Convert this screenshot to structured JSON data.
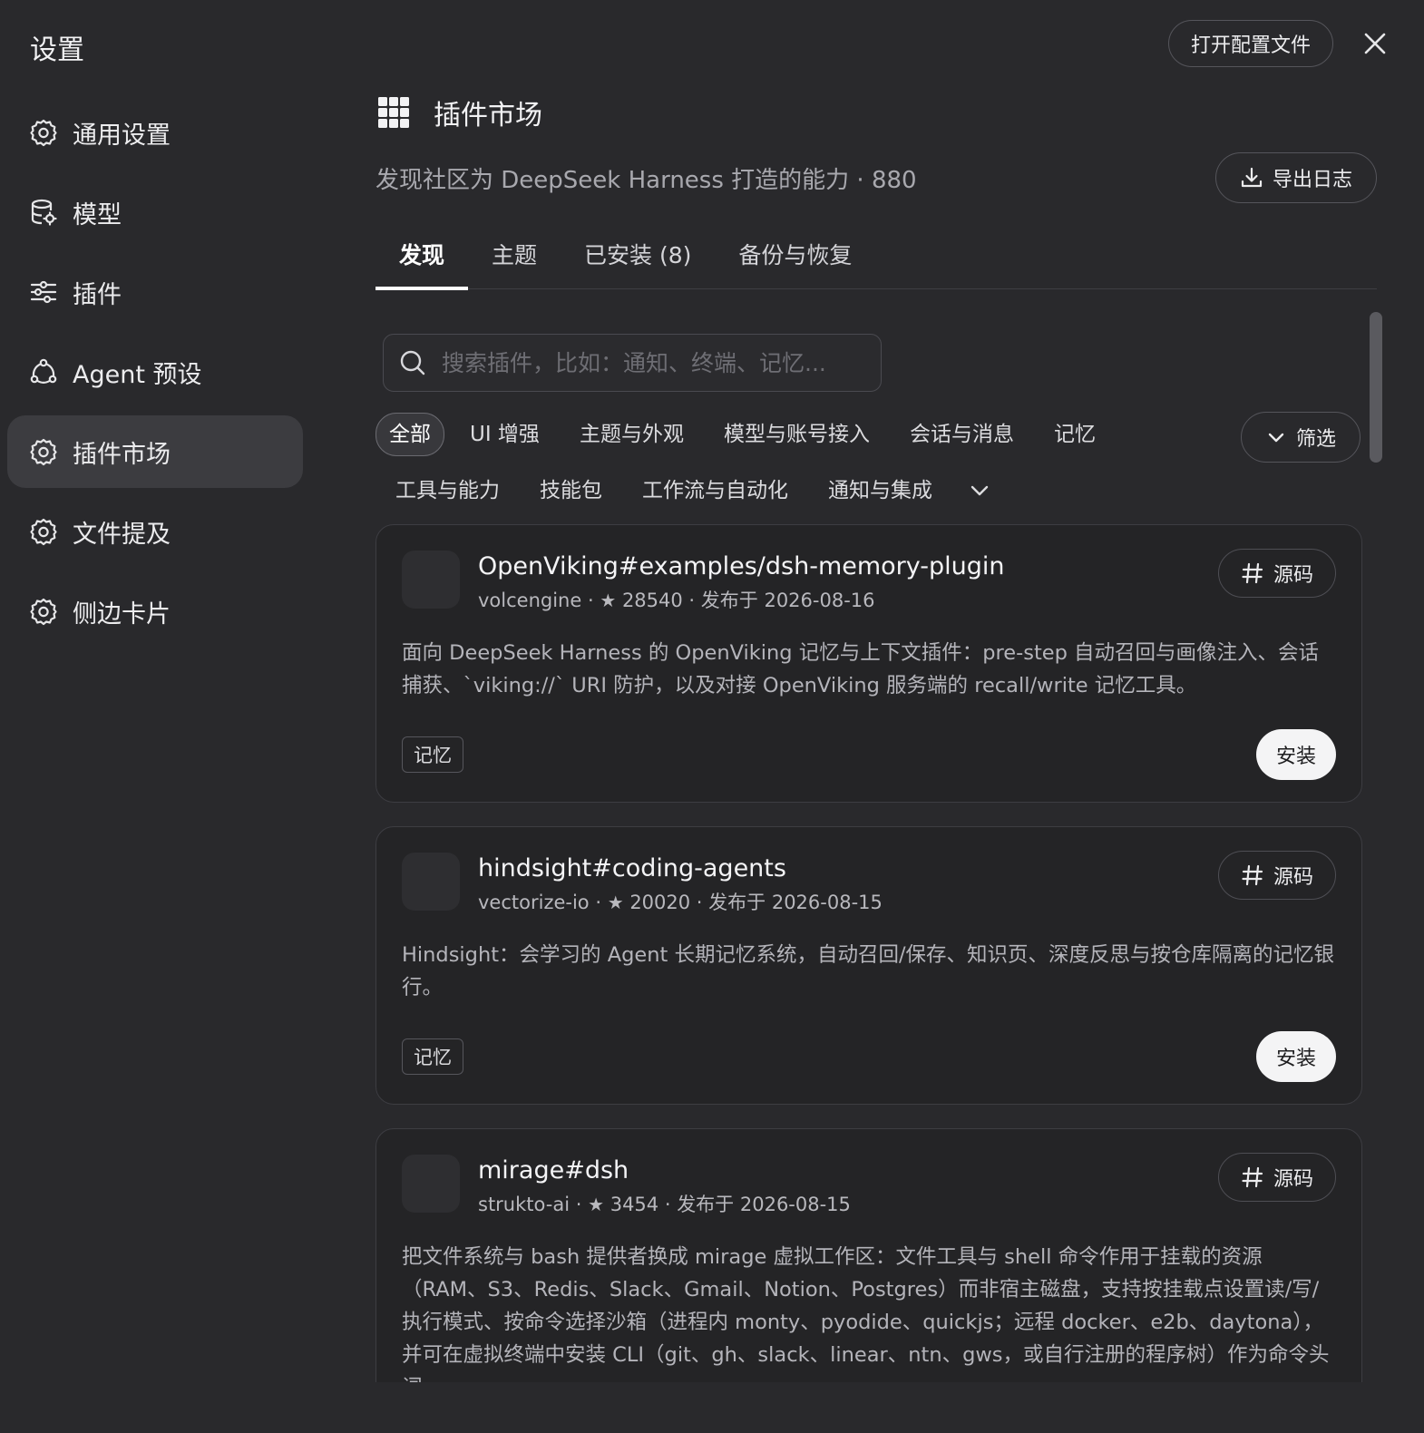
{
  "window": {
    "title": "设置",
    "open_config_label": "打开配置文件",
    "close_icon": "close-icon"
  },
  "sidebar": {
    "items": [
      {
        "label": "通用设置",
        "icon": "gear-icon",
        "active": false
      },
      {
        "label": "模型",
        "icon": "database-icon",
        "active": false
      },
      {
        "label": "插件",
        "icon": "sliders-icon",
        "active": false
      },
      {
        "label": "Agent 预设",
        "icon": "agent-icon",
        "active": false
      },
      {
        "label": "插件市场",
        "icon": "gear-icon",
        "active": true
      },
      {
        "label": "文件提及",
        "icon": "gear-icon",
        "active": false
      },
      {
        "label": "侧边卡片",
        "icon": "gear-icon",
        "active": false
      }
    ]
  },
  "market": {
    "title": "插件市场",
    "icon": "grid-icon",
    "subtitle": "发现社区为 DeepSeek Harness 打造的能力 · 880",
    "export_label": "导出日志",
    "tabs": [
      {
        "label": "发现",
        "active": true
      },
      {
        "label": "主题",
        "active": false
      },
      {
        "label": "已安装 (8)",
        "active": false
      },
      {
        "label": "备份与恢复",
        "active": false
      }
    ],
    "search": {
      "placeholder": "搜索插件，比如：通知、终端、记忆...",
      "value": ""
    },
    "filter_label": "筛选",
    "categories_row1": [
      "全部",
      "UI 增强",
      "主题与外观",
      "模型与账号接入",
      "会话与消息",
      "记忆"
    ],
    "categories_row2": [
      "工具与能力",
      "技能包",
      "工作流与自动化",
      "通知与集成"
    ],
    "active_category": "全部",
    "source_label": "源码",
    "install_label": "安装",
    "plugins": [
      {
        "name": "OpenViking#examples/dsh-memory-plugin",
        "author": "volcengine",
        "stars": "28540",
        "published": "发布于 2026-08-16",
        "description": "面向 DeepSeek Harness 的 OpenViking 记忆与上下文插件：pre-step 自动召回与画像注入、会话捕获、`viking://` URI 防护，以及对接 OpenViking 服务端的 recall/write 记忆工具。",
        "tag": "记忆"
      },
      {
        "name": "hindsight#coding-agents",
        "author": "vectorize-io",
        "stars": "20020",
        "published": "发布于 2026-08-15",
        "description": "Hindsight：会学习的 Agent 长期记忆系统，自动召回/保存、知识页、深度反思与按仓库隔离的记忆银行。",
        "tag": "记忆"
      },
      {
        "name": "mirage#dsh",
        "author": "strukto-ai",
        "stars": "3454",
        "published": "发布于 2026-08-15",
        "description": "把文件系统与 bash 提供者换成 mirage 虚拟工作区：文件工具与 shell 命令作用于挂载的资源（RAM、S3、Redis、Slack、Gmail、Notion、Postgres）而非宿主磁盘，支持按挂载点设置读/写/执行模式、按命令选择沙箱（进程内 monty、pyodide、quickjs；远程 docker、e2b、daytona），并可在虚拟终端中安装 CLI（git、gh、slack、linear、ntn、gws，或自行注册的程序树）作为命令头词。",
        "tag": ""
      }
    ]
  }
}
